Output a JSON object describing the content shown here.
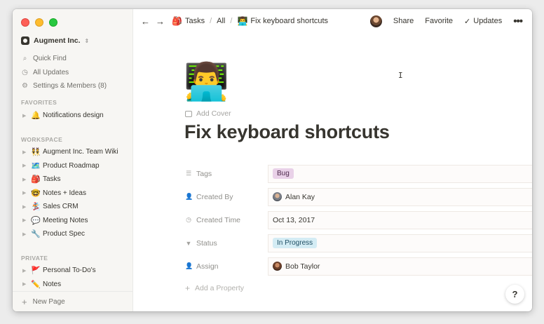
{
  "window": {
    "traffic_lights": {
      "close": "#fd5f57",
      "minimize": "#febc2e",
      "zoom": "#28c840"
    }
  },
  "sidebar": {
    "workspace_name": "Augment Inc.",
    "links": [
      {
        "icon": "search-icon",
        "label": "Quick Find"
      },
      {
        "icon": "clock-icon",
        "label": "All Updates"
      },
      {
        "icon": "gear-icon",
        "label": "Settings & Members (8)"
      }
    ],
    "favorites_label": "FAVORITES",
    "favorites": [
      {
        "emoji": "🔔",
        "label": "Notifications design"
      }
    ],
    "workspace_label": "WORKSPACE",
    "workspace_items": [
      {
        "emoji": "👯",
        "label": "Augment Inc. Team Wiki"
      },
      {
        "emoji": "🗺️",
        "label": "Product Roadmap"
      },
      {
        "emoji": "🎒",
        "label": "Tasks"
      },
      {
        "emoji": "🤓",
        "label": "Notes + Ideas"
      },
      {
        "emoji": "🏂",
        "label": "Sales CRM"
      },
      {
        "emoji": "💬",
        "label": "Meeting Notes"
      },
      {
        "emoji": "🔧",
        "label": "Product Spec"
      }
    ],
    "private_label": "PRIVATE",
    "private_items": [
      {
        "emoji": "🚩",
        "label": "Personal To-Do's"
      },
      {
        "emoji": "✏️",
        "label": "Notes"
      }
    ],
    "new_page_label": "New Page"
  },
  "topbar": {
    "breadcrumbs": [
      {
        "emoji": "🎒",
        "label": "Tasks"
      },
      {
        "emoji": "",
        "label": "All"
      },
      {
        "emoji": "👨‍💻",
        "label": "Fix keyboard shortcuts"
      }
    ],
    "share_label": "Share",
    "favorite_label": "Favorite",
    "updates_label": "Updates"
  },
  "page": {
    "icon": "👨‍💻",
    "add_cover_label": "Add Cover",
    "title": "Fix keyboard shortcuts",
    "properties": [
      {
        "icon": "list-icon",
        "label": "Tags",
        "type": "pill",
        "value": "Bug",
        "color": "#e9d1e8"
      },
      {
        "icon": "person-icon",
        "label": "Created By",
        "type": "person",
        "value": "Alan Kay"
      },
      {
        "icon": "clock-icon",
        "label": "Created Time",
        "type": "text",
        "value": "Oct 13, 2017"
      },
      {
        "icon": "status-icon",
        "label": "Status",
        "type": "pill",
        "value": "In Progress",
        "color": "#d4ecf4"
      },
      {
        "icon": "person-icon",
        "label": "Assign",
        "type": "person",
        "value": "Bob Taylor"
      }
    ],
    "add_property_label": "Add a Property"
  },
  "help_label": "?"
}
